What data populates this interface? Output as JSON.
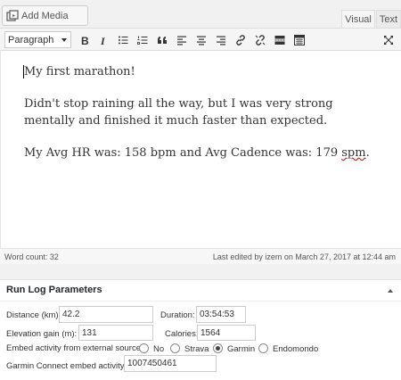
{
  "add_media": {
    "label": "Add Media",
    "icon": "media-icon"
  },
  "tabs": {
    "visual": "Visual",
    "text": "Text"
  },
  "toolbar": {
    "format_value": "Paragraph",
    "buttons": [
      "bold",
      "italic",
      "bulleted-list",
      "numbered-list",
      "blockquote",
      "align-left",
      "align-center",
      "align-right",
      "insert-link",
      "remove-link",
      "read-more",
      "toolbar-toggle"
    ],
    "fullscreen": "fullscreen"
  },
  "content": {
    "p1": "My first marathon!",
    "p2": "Didn't stop raining all the way, but I was very strong mentally and finished it much faster than expected.",
    "p3_pre": "My Avg HR was: 158 bpm and Avg Cadence was: 179 ",
    "p3_spm": "spm",
    "p3_post": "."
  },
  "status": {
    "word_count": "Word count: 32",
    "last_edited": "Last edited by izem on March 27, 2017 at 12:44 am"
  },
  "metabox": {
    "title": "Run Log Parameters",
    "distance_label": "Distance (km):",
    "distance_value": "42.2",
    "duration_label": "Duration:",
    "duration_value": "03:54:53",
    "elevation_label": "Elevation gain (m):",
    "elevation_value": "131",
    "calories_label": "Calories:",
    "calories_value": "1564",
    "embed_label": "Embed activity from external source:",
    "options": [
      "No",
      "Strava",
      "Garmin",
      "Endomondo"
    ],
    "selected_option": "Garmin",
    "garmin_label": "Garmin Connect embed activity:",
    "garmin_value": "1007450461"
  },
  "colors": {
    "spellcheck": "#dd0000",
    "toolbar_bg": "#f5f5f5"
  }
}
